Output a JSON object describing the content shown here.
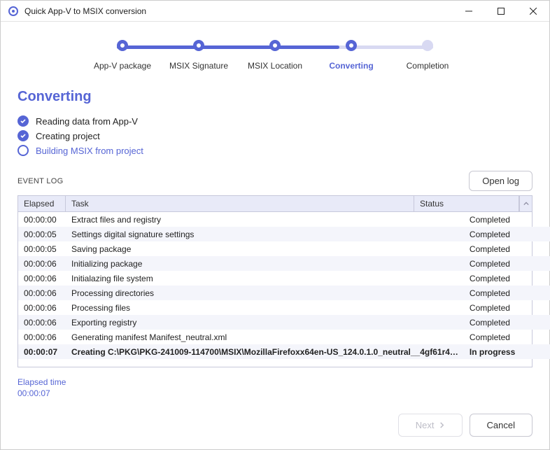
{
  "window_title": "Quick App-V to MSIX conversion",
  "wizard_steps": [
    {
      "label": "App-V package",
      "state": "done"
    },
    {
      "label": "MSIX Signature",
      "state": "done"
    },
    {
      "label": "MSIX Location",
      "state": "done"
    },
    {
      "label": "Converting",
      "state": "active"
    },
    {
      "label": "Completion",
      "state": "future"
    }
  ],
  "section_title": "Converting",
  "tasks": [
    {
      "label": "Reading data from App-V",
      "state": "completed"
    },
    {
      "label": "Creating project",
      "state": "completed"
    },
    {
      "label": "Building MSIX from project",
      "state": "current"
    }
  ],
  "event_log_title": "EVENT LOG",
  "open_log_label": "Open log",
  "columns": {
    "elapsed": "Elapsed",
    "task": "Task",
    "status": "Status"
  },
  "rows": [
    {
      "elapsed": "00:00:00",
      "task": "Extract files and registry",
      "status": "Completed"
    },
    {
      "elapsed": "00:00:05",
      "task": "Settings digital signature settings",
      "status": "Completed"
    },
    {
      "elapsed": "00:00:05",
      "task": "Saving package",
      "status": "Completed"
    },
    {
      "elapsed": "00:00:06",
      "task": "Initializing package",
      "status": "Completed"
    },
    {
      "elapsed": "00:00:06",
      "task": "Initialazing file system",
      "status": "Completed"
    },
    {
      "elapsed": "00:00:06",
      "task": "Processing directories",
      "status": "Completed"
    },
    {
      "elapsed": "00:00:06",
      "task": "Processing files",
      "status": "Completed"
    },
    {
      "elapsed": "00:00:06",
      "task": "Exporting registry",
      "status": "Completed"
    },
    {
      "elapsed": "00:00:06",
      "task": "Generating manifest Manifest_neutral.xml",
      "status": "Completed"
    },
    {
      "elapsed": "00:00:07",
      "task": "Creating C:\\PKG\\PKG-241009-114700\\MSIX\\MozillaFirefoxx64en-US_124.0.1.0_neutral__4gf61r4…",
      "status": "In progress"
    }
  ],
  "elapsed_label": "Elapsed time",
  "elapsed_value": "00:00:07",
  "footer": {
    "next": "Next",
    "cancel": "Cancel"
  }
}
